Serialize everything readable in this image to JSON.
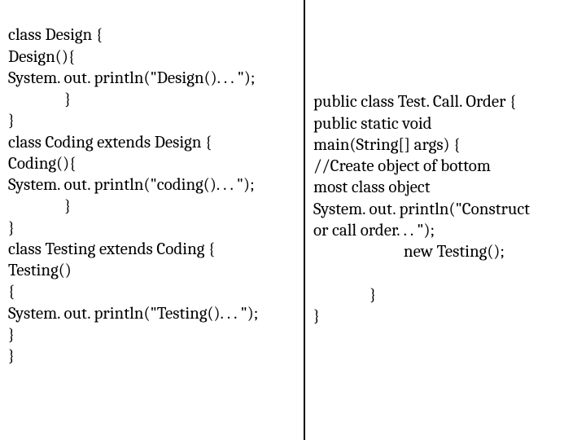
{
  "left": {
    "l1": "class Design {",
    "l2": "Design(){",
    "l3": "System. out. println(\"Design(). . . \");",
    "l4": "               }",
    "l5": "}",
    "l6": "class Coding extends Design {",
    "l7": "Coding(){",
    "l8": "System. out. println(\"coding(). . . \");",
    "l9": "               }",
    "l10": "}",
    "l11": "class Testing extends Coding {",
    "l12": "Testing()",
    "l13": "{",
    "l14": "System. out. println(\"Testing(). . . \");",
    "l15": "}",
    "l16": "}"
  },
  "right": {
    "r1": "public class Test. Call. Order {",
    "r2": "public static void",
    "r3": "main(String[] args) {",
    "r4": "//Create object of bottom",
    "r5": "most class object",
    "r6": "System. out. println(\"Construct",
    "r7": "or call order. . . \");",
    "r8": "                        new Testing();",
    "r9": "",
    "r10": "               }",
    "r11": "}"
  }
}
